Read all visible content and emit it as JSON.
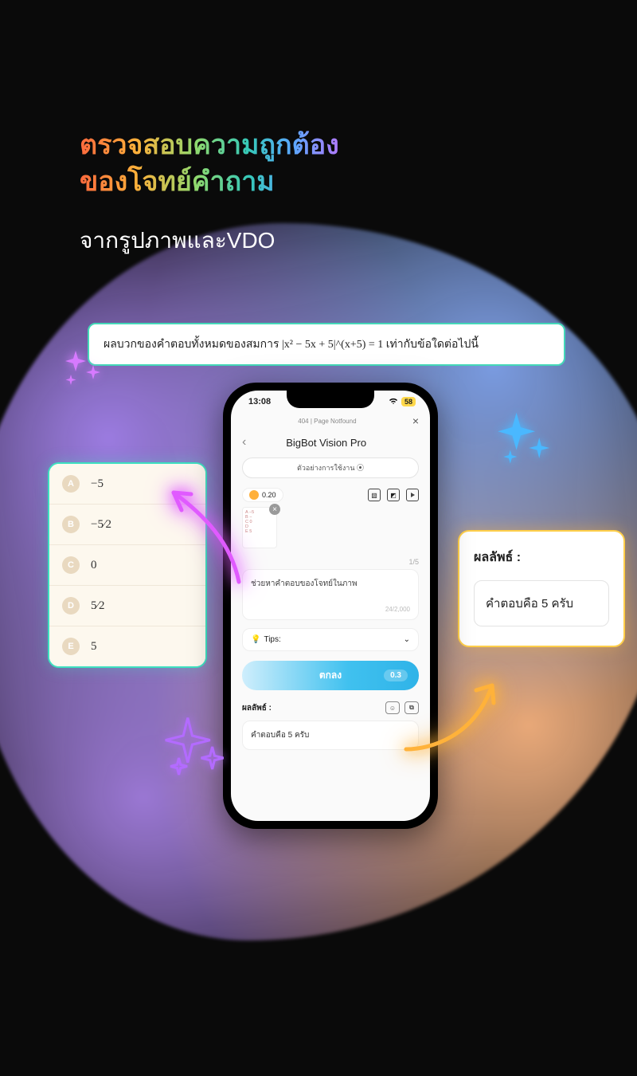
{
  "heading_line1": "ตรวจสอบความถูกต้อง",
  "heading_line2": "ของโจทย์คำถาม",
  "subheading": "จากรูปภาพและVDO",
  "question_text": "ผลบวกของคำตอบทั้งหมดของสมการ |x² − 5x + 5|^(x+5) = 1 เท่ากับข้อใดต่อไปนี้",
  "options": [
    {
      "letter": "A",
      "value": "−5"
    },
    {
      "letter": "B",
      "value": "−5⁄2"
    },
    {
      "letter": "C",
      "value": "0"
    },
    {
      "letter": "D",
      "value": "5⁄2"
    },
    {
      "letter": "E",
      "value": "5"
    }
  ],
  "result": {
    "title": "ผลลัพธ์ :",
    "text": "คำตอบคือ 5 ครับ"
  },
  "phone": {
    "time": "13:08",
    "battery": "58",
    "page_notfound": "404 | Page Notfound",
    "app_title": "BigBot Vision Pro",
    "usage_label": "ตัวอย่างการใช้งาน ⦿",
    "credit": "0.20",
    "image_counter": "1/5",
    "input_text": "ช่วยหาคำตอบของโจทย์ในภาพ",
    "char_counter": "24/2,000",
    "tips_label": "Tips:",
    "submit_label": "ตกลง",
    "submit_cost": "0.3",
    "result_label": "ผลลัพธ์ :",
    "result_text": "คำตอบคือ 5 ครับ"
  }
}
